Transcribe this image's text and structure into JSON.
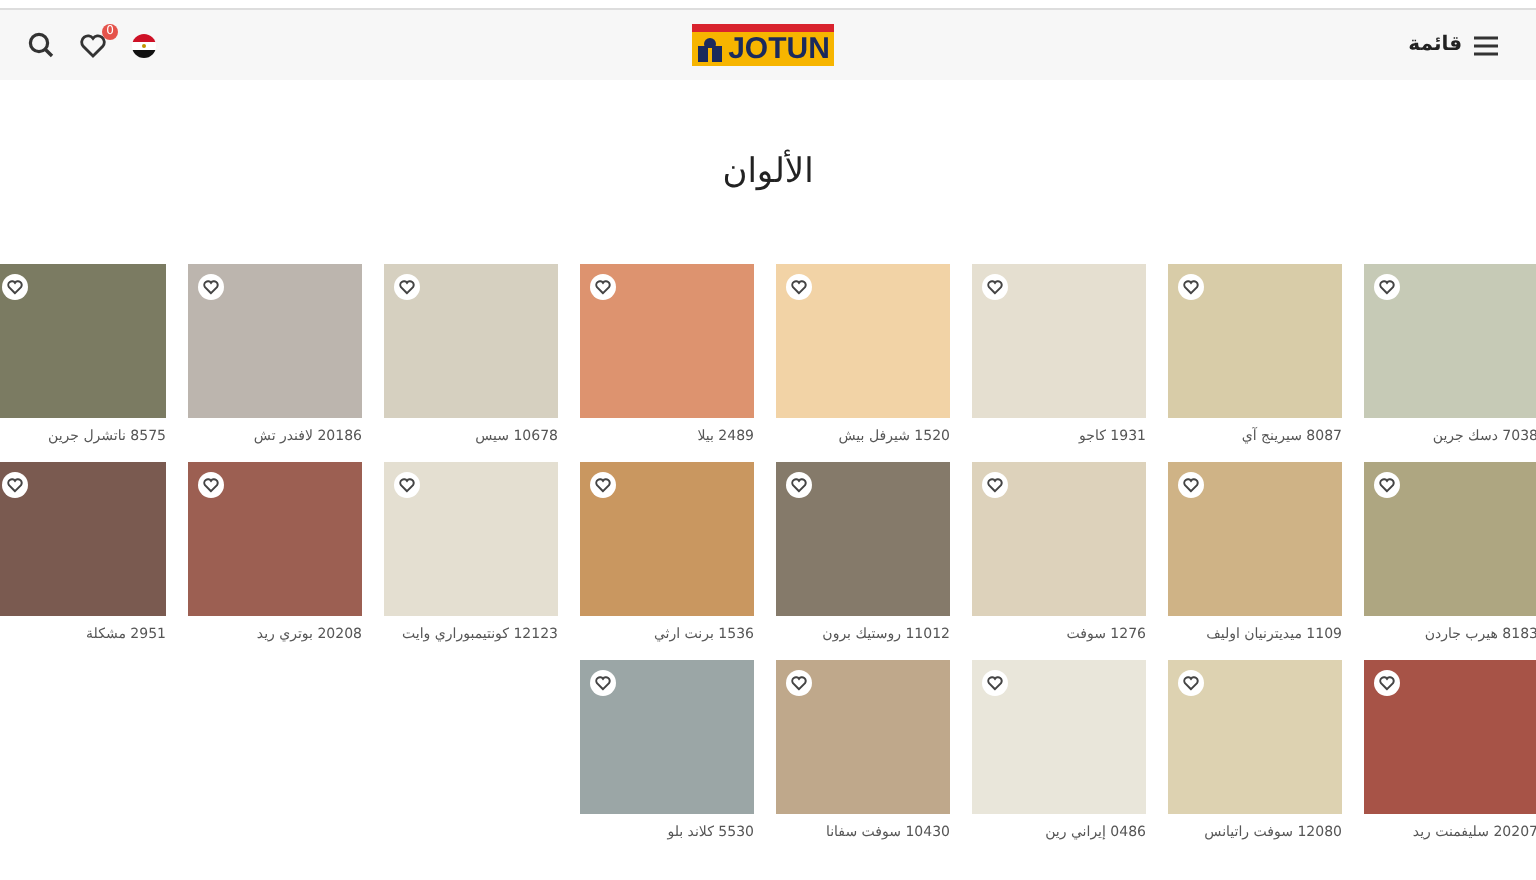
{
  "header": {
    "menu_label": "قائمة",
    "logo_text": "JOTUN",
    "wishlist_count": "0"
  },
  "title": "الألوان",
  "colors": [
    {
      "code": "7038",
      "name": "دسك جرين",
      "color": "#c6cab6"
    },
    {
      "code": "8087",
      "name": "سيرينج آي",
      "color": "#d8cca8"
    },
    {
      "code": "1931",
      "name": "كاجو",
      "color": "#e5dfd0"
    },
    {
      "code": "1520",
      "name": "شيرفل بيش",
      "color": "#f2d3a6"
    },
    {
      "code": "2489",
      "name": "بيلا",
      "color": "#dd936f"
    },
    {
      "code": "10678",
      "name": "سيس",
      "color": "#d6d0c0"
    },
    {
      "code": "20186",
      "name": "لافندر تش",
      "color": "#bcb5ae"
    },
    {
      "code": "8575",
      "name": "ناتشرل جرين",
      "color": "#7b7b62"
    },
    {
      "code": "8183",
      "name": "هيرب جاردن",
      "color": "#aea681"
    },
    {
      "code": "1109",
      "name": "ميديترنيان اوليف",
      "color": "#cfb386"
    },
    {
      "code": "1276",
      "name": "سوفت",
      "color": "#ddd2bb"
    },
    {
      "code": "11012",
      "name": "روستيك برون",
      "color": "#857a6a"
    },
    {
      "code": "1536",
      "name": "برنت ارثي",
      "color": "#c99760"
    },
    {
      "code": "12123",
      "name": "كونتيمبوراري وايت",
      "color": "#e4dfd1"
    },
    {
      "code": "20208",
      "name": "بوتري ريد",
      "color": "#9c5f52"
    },
    {
      "code": "2951",
      "name": "مشكلة",
      "color": "#7a5a50"
    },
    {
      "code": "20207",
      "name": "سليفمنت ريد",
      "color": "#a75347"
    },
    {
      "code": "12080",
      "name": "سوفت راتيانس",
      "color": "#ddd2b1"
    },
    {
      "code": "0486",
      "name": "إيراني رين",
      "color": "#e9e6da"
    },
    {
      "code": "10430",
      "name": "سوفت سفانا",
      "color": "#bfa88b"
    },
    {
      "code": "5530",
      "name": "كلاند بلو",
      "color": "#9ba6a6"
    }
  ]
}
